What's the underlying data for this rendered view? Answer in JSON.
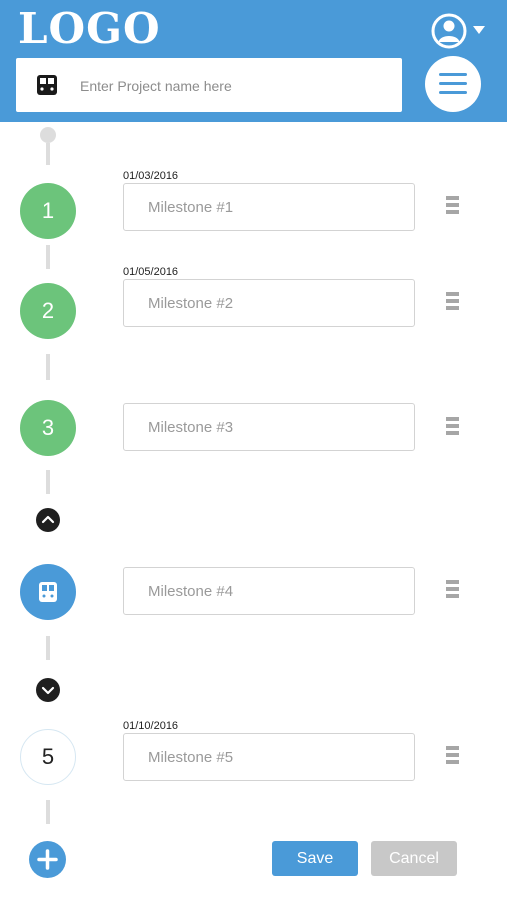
{
  "header": {
    "logo_text": "LOGO",
    "project_input": {
      "placeholder": "Enter Project name here",
      "value": ""
    },
    "icons": {
      "profile": "user-circle-icon",
      "dropdown": "caret-down-icon",
      "project": "train-icon",
      "menu": "hamburger-icon"
    }
  },
  "milestones": [
    {
      "step": "1",
      "status": "completed",
      "date": "01/03/2016",
      "placeholder": "Milestone #1"
    },
    {
      "step": "2",
      "status": "completed",
      "date": "01/05/2016",
      "placeholder": "Milestone #2"
    },
    {
      "step": "3",
      "status": "completed",
      "date": "",
      "placeholder": "Milestone #3"
    },
    {
      "step": "",
      "status": "current",
      "icon": "train-icon",
      "date": "",
      "placeholder": "Milestone #4"
    },
    {
      "step": "5",
      "status": "pending",
      "date": "01/10/2016",
      "placeholder": "Milestone #5"
    }
  ],
  "controls": {
    "collapse_icon": "chevron-up-icon",
    "expand_icon": "chevron-down-icon",
    "add_icon": "plus-icon"
  },
  "footer": {
    "save_label": "Save",
    "cancel_label": "Cancel"
  },
  "colors": {
    "primary": "#4a9ad8",
    "completed": "#6cc47b",
    "cancel": "#c8c8c8",
    "track": "#dddddd"
  }
}
